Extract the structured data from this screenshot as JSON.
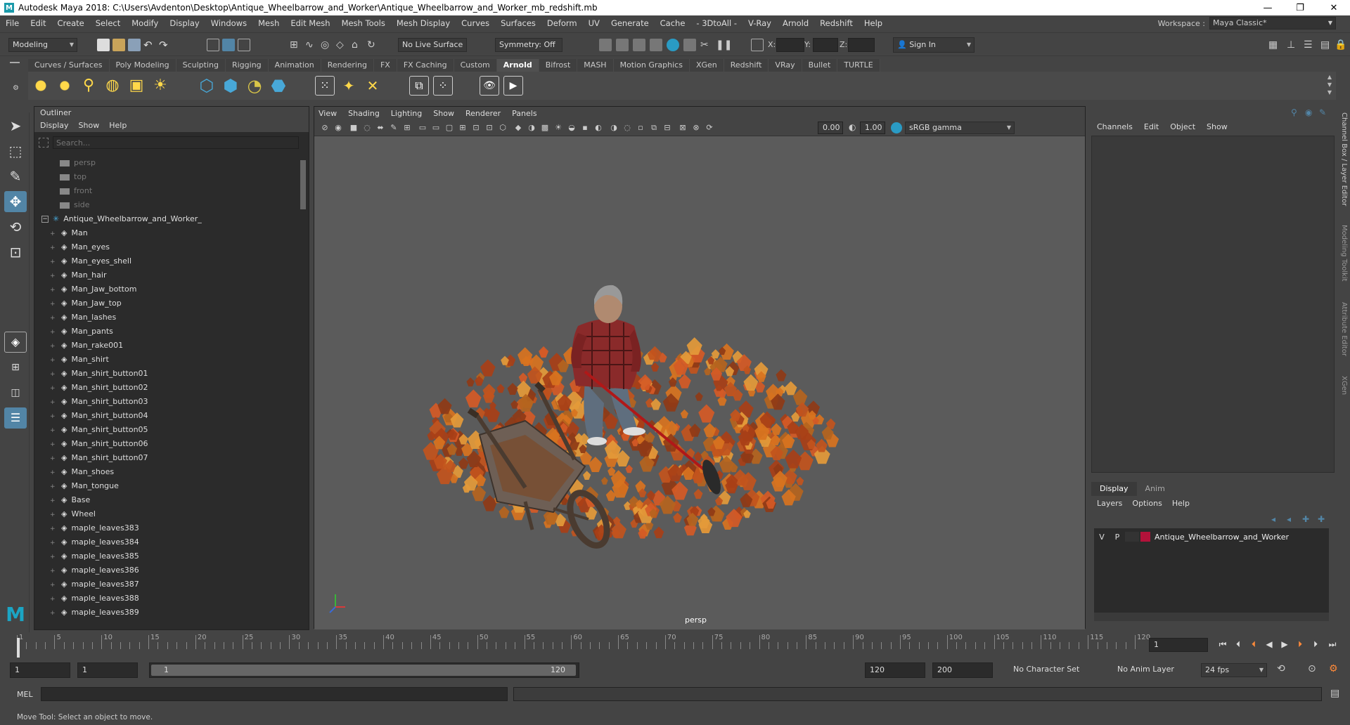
{
  "window": {
    "title": "Autodesk Maya 2018: C:\\Users\\Avdenton\\Desktop\\Antique_Wheelbarrow_and_Worker\\Antique_Wheelbarrow_and_Worker_mb_redshift.mb",
    "minimize": "—",
    "maximize": "❐",
    "close": "✕"
  },
  "menubar": [
    "File",
    "Edit",
    "Create",
    "Select",
    "Modify",
    "Display",
    "Windows",
    "Mesh",
    "Edit Mesh",
    "Mesh Tools",
    "Mesh Display",
    "Curves",
    "Surfaces",
    "Deform",
    "UV",
    "Generate",
    "Cache",
    "- 3DtoAll -",
    "V-Ray",
    "Arnold",
    "Redshift",
    "Help"
  ],
  "workspace": {
    "label": "Workspace :",
    "value": "Maya Classic*"
  },
  "statusline": {
    "mode": "Modeling",
    "live_surface": "No Live Surface",
    "symmetry": "Symmetry: Off",
    "x_label": "X:",
    "y_label": "Y:",
    "z_label": "Z:",
    "sign_in": "Sign In"
  },
  "shelf_tabs": [
    "Curves / Surfaces",
    "Poly Modeling",
    "Sculpting",
    "Rigging",
    "Animation",
    "Rendering",
    "FX",
    "FX Caching",
    "Custom",
    "Arnold",
    "Bifrost",
    "MASH",
    "Motion Graphics",
    "XGen",
    "Redshift",
    "VRay",
    "Bullet",
    "TURTLE"
  ],
  "active_shelf": "Arnold",
  "outliner": {
    "title": "Outliner",
    "menu": [
      "Display",
      "Show",
      "Help"
    ],
    "search_placeholder": "Search...",
    "cameras": [
      "persp",
      "top",
      "front",
      "side"
    ],
    "group": "Antique_Wheelbarrow_and_Worker_",
    "items": [
      "Man",
      "Man_eyes",
      "Man_eyes_shell",
      "Man_hair",
      "Man_Jaw_bottom",
      "Man_Jaw_top",
      "Man_lashes",
      "Man_pants",
      "Man_rake001",
      "Man_shirt",
      "Man_shirt_button01",
      "Man_shirt_button02",
      "Man_shirt_button03",
      "Man_shirt_button04",
      "Man_shirt_button05",
      "Man_shirt_button06",
      "Man_shirt_button07",
      "Man_shoes",
      "Man_tongue",
      "Base",
      "Wheel",
      "maple_leaves383",
      "maple_leaves384",
      "maple_leaves385",
      "maple_leaves386",
      "maple_leaves387",
      "maple_leaves388",
      "maple_leaves389"
    ]
  },
  "viewport": {
    "menu": [
      "View",
      "Shading",
      "Lighting",
      "Show",
      "Renderer",
      "Panels"
    ],
    "exposure": "0.00",
    "gamma": "1.00",
    "color_space": "sRGB gamma",
    "camera_label": "persp"
  },
  "channel_box": {
    "menu": [
      "Channels",
      "Edit",
      "Object",
      "Show"
    ],
    "layer_tabs": [
      "Display",
      "Anim"
    ],
    "layer_menu": [
      "Layers",
      "Options",
      "Help"
    ],
    "layer": {
      "v": "V",
      "p": "P",
      "name": "Antique_Wheelbarrow_and_Worker",
      "color": "#b3123a"
    }
  },
  "side_tabs": [
    "Channel Box / Layer Editor",
    "Modeling Toolkit",
    "Attribute Editor",
    "XGen"
  ],
  "timeline": {
    "ticks": [
      "1",
      "5",
      "10",
      "15",
      "20",
      "25",
      "30",
      "35",
      "40",
      "45",
      "50",
      "55",
      "60",
      "65",
      "70",
      "75",
      "80",
      "85",
      "90",
      "95",
      "100",
      "105",
      "110",
      "115",
      "120"
    ],
    "current_frame": "1",
    "range_start": "1",
    "playback_start": "1",
    "slider_start": "1",
    "slider_end": "120",
    "playback_end": "120",
    "range_end": "200",
    "character_set": "No Character Set",
    "anim_layer": "No Anim Layer",
    "fps": "24 fps"
  },
  "command_line": {
    "label": "MEL"
  },
  "help_line": "Move Tool: Select an object to move.",
  "colors": {
    "accent": "#5285a6",
    "maya_logo": "#1ba5c4",
    "active_tool": "#5285a6"
  }
}
